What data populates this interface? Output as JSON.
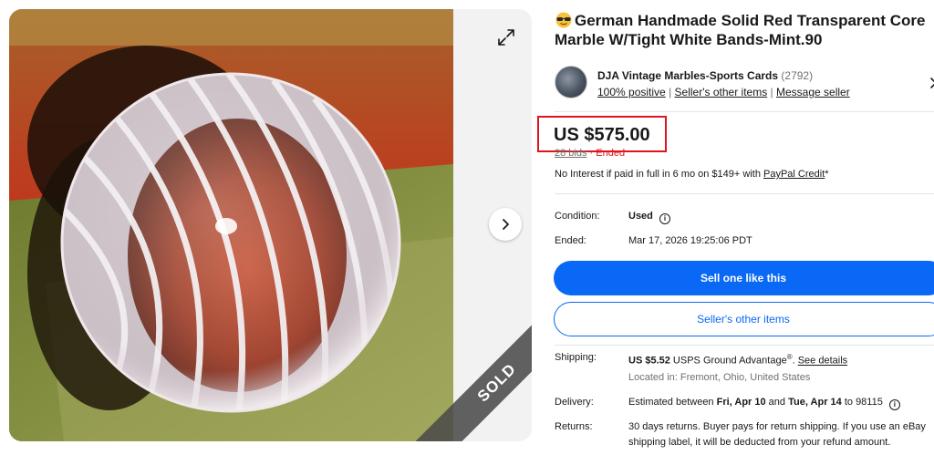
{
  "listing": {
    "title": "German Handmade Solid Red Transparent Core Marble W/Tight White Bands-Mint.90",
    "title_icon": "sunglasses-emoji-icon",
    "sold_ribbon": "SOLD"
  },
  "gallery": {
    "expand_icon": "expand-icon",
    "next_icon": "chevron-right-icon"
  },
  "seller": {
    "name": "DJA Vintage Marbles-Sports Cards",
    "feedback_count": "(2792)",
    "positive": "100% positive",
    "other_items": "Seller's other items",
    "message": "Message seller",
    "sep": "|"
  },
  "price": {
    "amount": "US $575.00",
    "bids": "28 bids",
    "dot": " · ",
    "status": "Ended"
  },
  "credit": {
    "text": "No Interest if paid in full in 6 mo on $149+ with ",
    "link": "PayPal Credit",
    "suffix": "*"
  },
  "details": {
    "condition_label": "Condition:",
    "condition_value": "Used",
    "ended_label": "Ended:",
    "ended_value": "Mar 17, 2026 19:25:06 PDT"
  },
  "buttons": {
    "sell_like": "Sell one like this",
    "other_items": "Seller's other items"
  },
  "shipping": {
    "label": "Shipping:",
    "cost": "US $5.52",
    "service": " USPS Ground Advantage",
    "reg": "®",
    "see_details": "See details",
    "location": "Located in: Fremont, Ohio, United States"
  },
  "delivery": {
    "label": "Delivery:",
    "prefix": "Estimated between ",
    "start": "Fri, Apr 10",
    "and": " and ",
    "end": "Tue, Apr 14",
    "suffix": " to 98115"
  },
  "returns": {
    "label": "Returns:",
    "line1": "30 days returns. Buyer pays for return shipping. If you use an eBay",
    "line2": "shipping label, it will be deducted from your refund amount."
  }
}
